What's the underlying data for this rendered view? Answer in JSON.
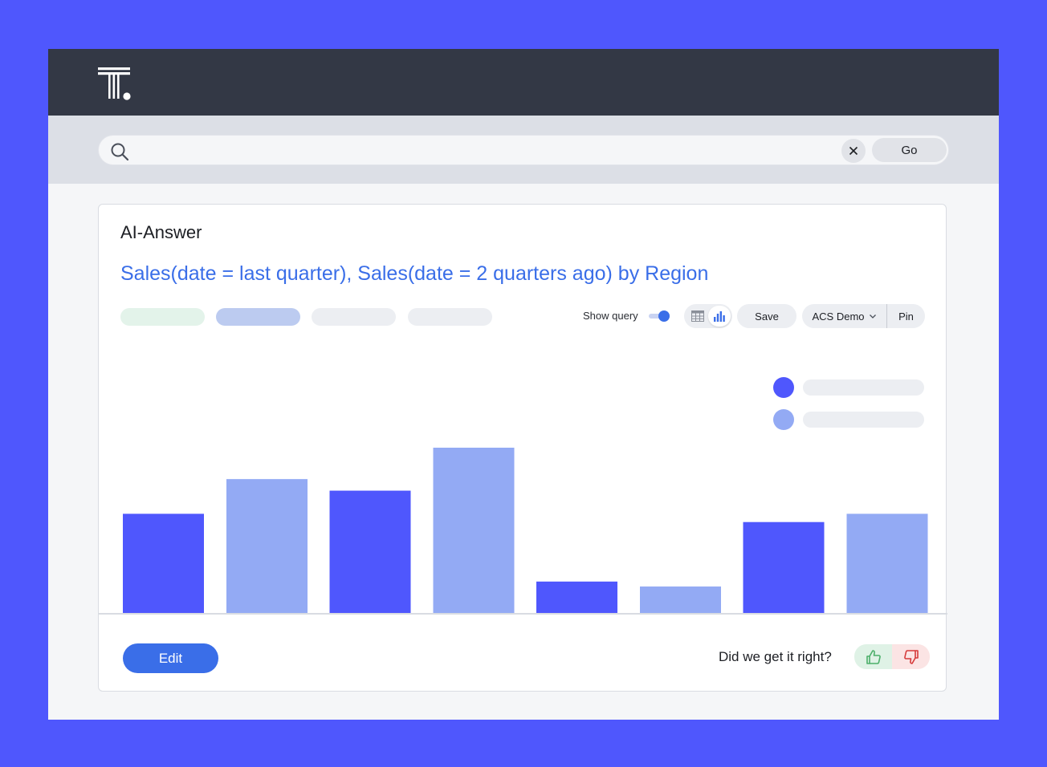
{
  "search": {
    "value": "",
    "placeholder": "",
    "go_label": "Go"
  },
  "card": {
    "title": "AI-Answer",
    "query_title": "Sales(date = last quarter), Sales(date = 2 quarters ago) by Region"
  },
  "toolbar": {
    "show_query_label": "Show query",
    "show_query_on": true,
    "save_label": "Save",
    "acs_label": "ACS Demo",
    "pin_label": "Pin"
  },
  "chips": [
    {
      "color": "#e3f3ea"
    },
    {
      "color": "#bccbf0"
    },
    {
      "color": "#eceef2"
    },
    {
      "color": "#eceef2"
    }
  ],
  "legend": [
    {
      "color": "#4f57fd"
    },
    {
      "color": "#93aaf4"
    }
  ],
  "chart_data": {
    "type": "bar",
    "grid": false,
    "legend_position": "top-right",
    "ylim": [
      0,
      100
    ],
    "categories": [
      "",
      "",
      "",
      ""
    ],
    "series": [
      {
        "color": "#4f57fd",
        "values": [
          60,
          74,
          19,
          55
        ]
      },
      {
        "color": "#93aaf4",
        "values": [
          81,
          100,
          16,
          60
        ]
      }
    ]
  },
  "footer": {
    "edit_label": "Edit",
    "feedback_label": "Did we get it right?"
  },
  "colors": {
    "background": "#4f57fd",
    "topbar": "#333845",
    "accent": "#3a6ee8",
    "positive": "#4caf6a",
    "negative": "#d63a3a"
  }
}
